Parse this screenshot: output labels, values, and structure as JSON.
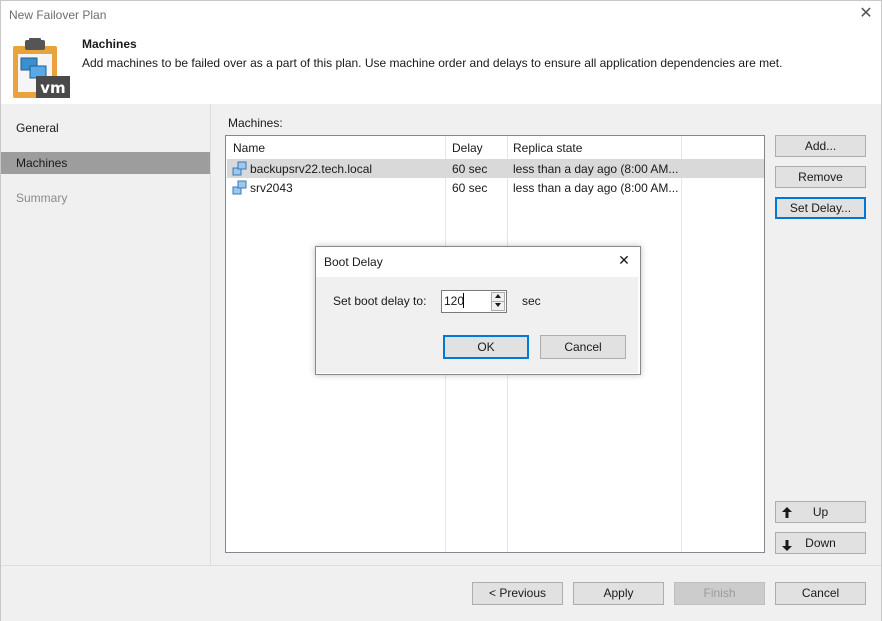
{
  "window": {
    "title": "New Failover Plan",
    "close_glyph": "✕"
  },
  "header": {
    "title": "Machines",
    "description": "Add machines to be failed over as a part of this plan. Use machine order and delays to ensure all application dependencies are met.",
    "icon": "vm-clipboard-icon",
    "icon_text": "vm"
  },
  "nav": {
    "items": [
      {
        "label": "General",
        "state": "normal"
      },
      {
        "label": "Machines",
        "state": "active"
      },
      {
        "label": "Summary",
        "state": "disabled"
      }
    ]
  },
  "machines": {
    "label": "Machines:",
    "columns": [
      "Name",
      "Delay",
      "Replica state"
    ],
    "rows": [
      {
        "name": "backupsrv22.tech.local",
        "delay": "60 sec",
        "state": "less than a day ago (8:00 AM...",
        "selected": true
      },
      {
        "name": "srv2043",
        "delay": "60 sec",
        "state": "less than a day ago (8:00 AM...",
        "selected": false
      }
    ]
  },
  "side_buttons": {
    "add": "Add...",
    "remove": "Remove",
    "set_delay": "Set Delay...",
    "up": "Up",
    "down": "Down"
  },
  "dialog": {
    "title": "Boot Delay",
    "close_glyph": "✕",
    "prompt": "Set boot delay to:",
    "value": "120",
    "unit": "sec",
    "ok": "OK",
    "cancel": "Cancel"
  },
  "footer": {
    "previous": "< Previous",
    "apply": "Apply",
    "finish": "Finish",
    "cancel": "Cancel"
  },
  "colors": {
    "accent": "#0078d7",
    "nav_active": "#9d9d9d",
    "selection": "#d9d9d9",
    "icon_orange": "#e8a33c",
    "icon_blue": "#3a8fd0"
  }
}
